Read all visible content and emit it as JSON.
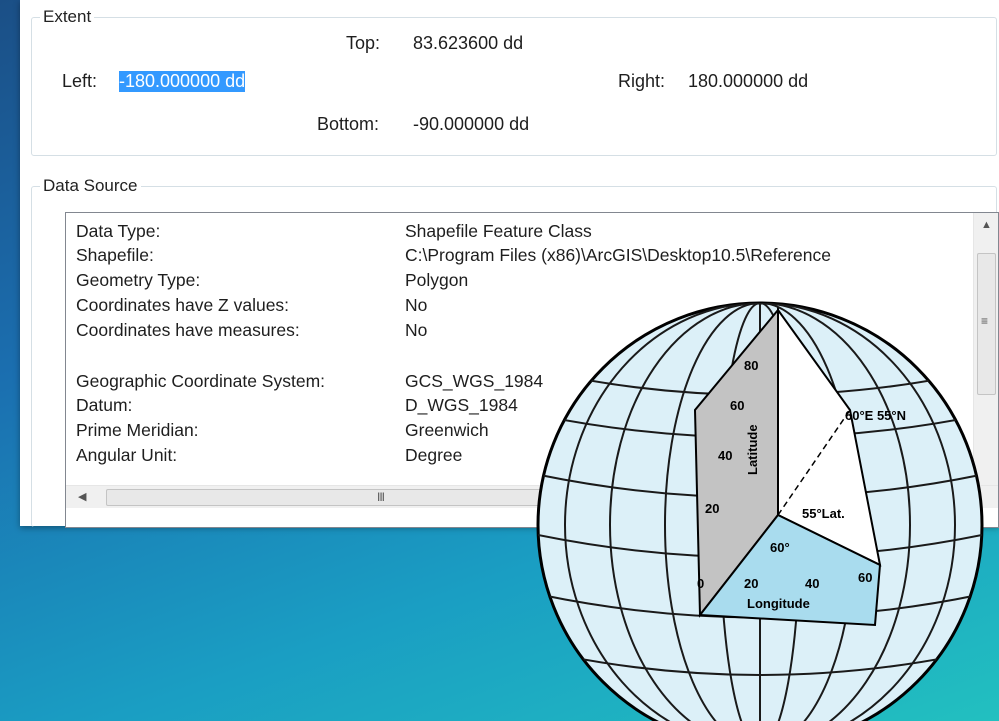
{
  "extent": {
    "title": "Extent",
    "top_label": "Top:",
    "top_value": "83.623600 dd",
    "left_label": "Left:",
    "left_value": "-180.000000 dd",
    "right_label": "Right:",
    "right_value": "180.000000 dd",
    "bottom_label": "Bottom:",
    "bottom_value": "-90.000000 dd",
    "selection_color": "#3399ff"
  },
  "data_source": {
    "title": "Data Source",
    "rows": [
      {
        "label": "Data Type:",
        "value": "Shapefile Feature Class"
      },
      {
        "label": "Shapefile:",
        "value": "C:\\Program Files (x86)\\ArcGIS\\Desktop10.5\\Reference"
      },
      {
        "label": "Geometry Type:",
        "value": "Polygon"
      },
      {
        "label": "Coordinates have Z values:",
        "value": "No"
      },
      {
        "label": "Coordinates have measures:",
        "value": "No"
      },
      {
        "label": "Geographic Coordinate System:",
        "value": "GCS_WGS_1984"
      },
      {
        "label": "Datum:",
        "value": "D_WGS_1984"
      },
      {
        "label": "Prime Meridian:",
        "value": "Greenwich"
      },
      {
        "label": "Angular Unit:",
        "value": "Degree"
      }
    ]
  },
  "globe": {
    "lat_ticks": [
      "80",
      "60",
      "40",
      "20"
    ],
    "lat_axis_label": "Latitude",
    "lon_ticks": [
      "0",
      "20",
      "40",
      "60"
    ],
    "lon_axis_label": "Longitude",
    "point_label": "60°E 55°N",
    "lat_angle_label": "55°Lat.",
    "lon_angle_label": "60°",
    "ocean_color": "#dcf0f8",
    "wedge_color": "#c3c3c3",
    "base_color": "#a9dcee"
  },
  "icons": {
    "scroll_up": "▲",
    "scroll_left": "◀",
    "grip_v": "≡",
    "grip_h": "III"
  }
}
